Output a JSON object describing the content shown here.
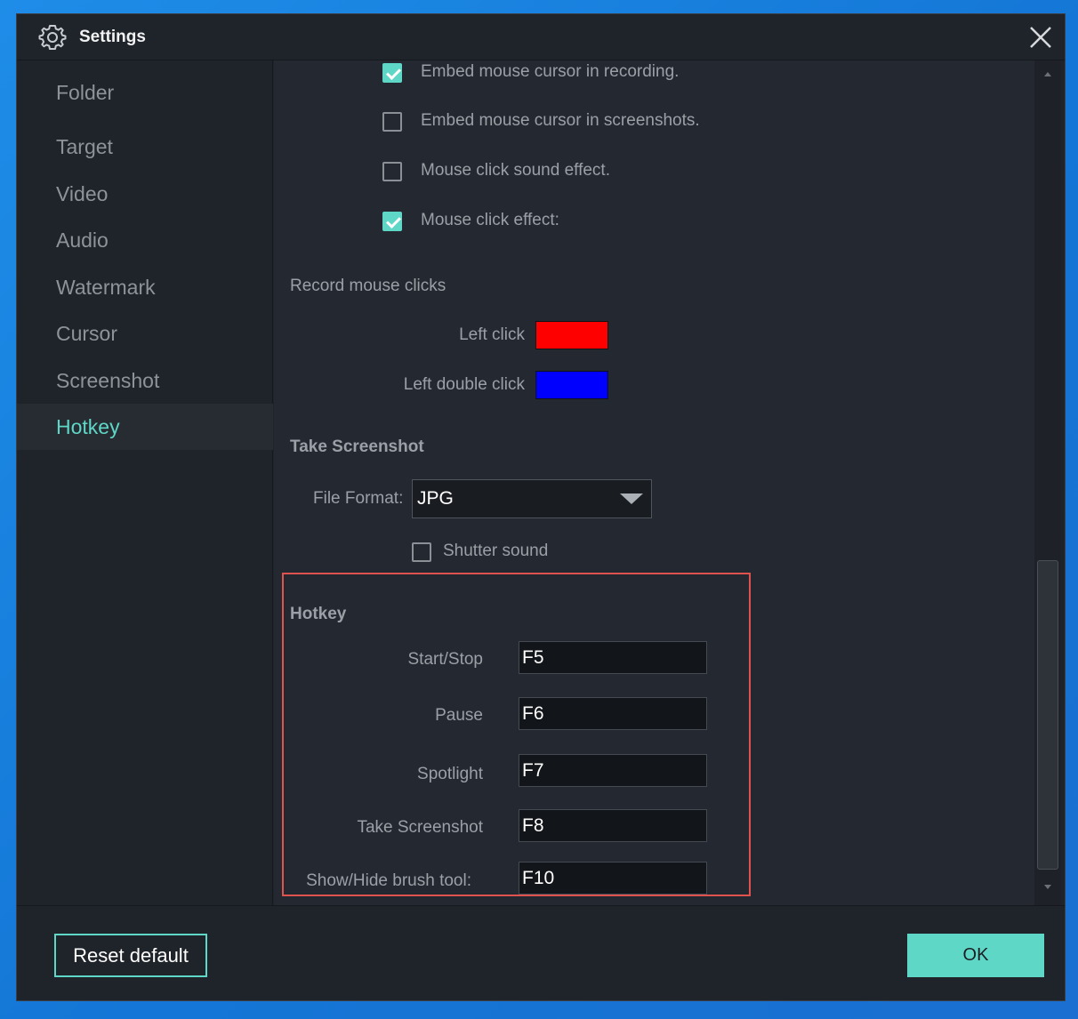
{
  "window": {
    "title": "Settings",
    "close_icon": "close-icon",
    "gear_icon": "gear-icon"
  },
  "sidebar": {
    "items": [
      {
        "label": "Folder",
        "active": false
      },
      {
        "label": "Target",
        "active": false
      },
      {
        "label": "Video",
        "active": false
      },
      {
        "label": "Audio",
        "active": false
      },
      {
        "label": "Watermark",
        "active": false
      },
      {
        "label": "Cursor",
        "active": false
      },
      {
        "label": "Screenshot",
        "active": false
      },
      {
        "label": "Hotkey",
        "active": true
      }
    ]
  },
  "cursor": {
    "options": [
      {
        "label": "Embed mouse cursor in recording.",
        "checked": true
      },
      {
        "label": "Embed mouse cursor in screenshots.",
        "checked": false
      },
      {
        "label": "Mouse click sound effect.",
        "checked": false
      },
      {
        "label": "Mouse click effect:",
        "checked": true
      }
    ],
    "record_clicks_label": "Record mouse clicks",
    "left_click_label": "Left click",
    "left_click_color": "#ff0000",
    "left_double_click_label": "Left double click",
    "left_double_click_color": "#0000ff"
  },
  "screenshot": {
    "title": "Take Screenshot",
    "file_format_label": "File Format:",
    "file_format_value": "JPG",
    "shutter_sound_label": "Shutter sound",
    "shutter_sound_checked": false
  },
  "hotkey": {
    "title": "Hotkey",
    "rows": [
      {
        "label": "Start/Stop",
        "value": "F5"
      },
      {
        "label": "Pause",
        "value": "F6"
      },
      {
        "label": "Spotlight",
        "value": "F7"
      },
      {
        "label": "Take Screenshot",
        "value": "F8"
      },
      {
        "label": "Show/Hide brush tool:",
        "value": "F10"
      }
    ]
  },
  "footer": {
    "reset_label": "Reset default",
    "ok_label": "OK"
  },
  "colors": {
    "accent": "#5fd7c6",
    "highlight_border": "#e0524d"
  }
}
